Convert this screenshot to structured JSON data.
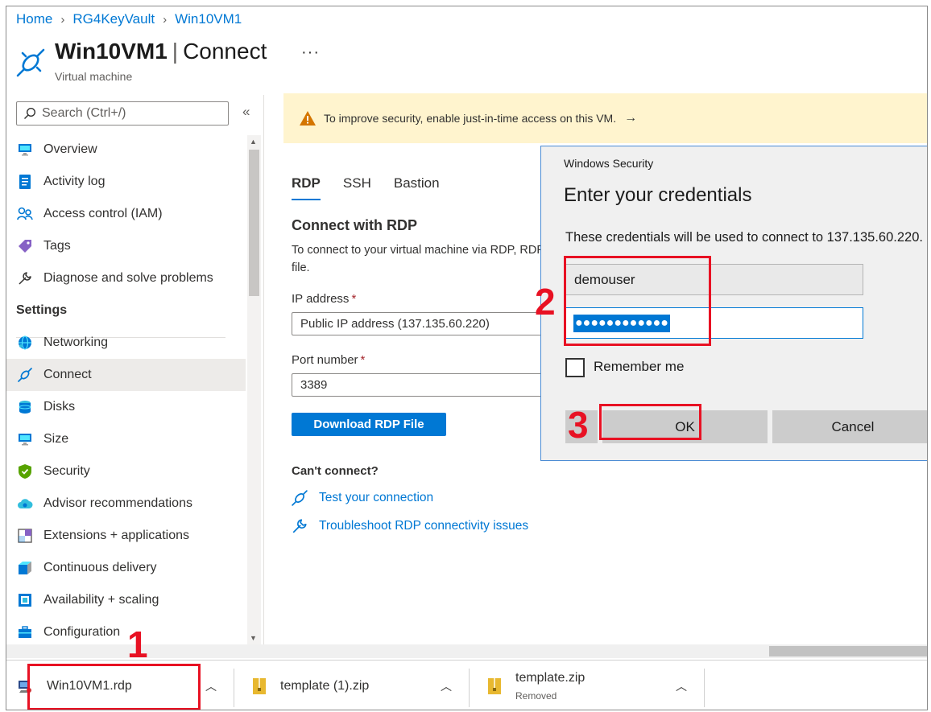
{
  "breadcrumb": [
    "Home",
    "RG4KeyVault",
    "Win10VM1"
  ],
  "header": {
    "resource": "Win10VM1",
    "page": "Connect",
    "subtitle": "Virtual machine",
    "more": "···"
  },
  "sidebar": {
    "search_placeholder": "Search (Ctrl+/)",
    "collapse": "«",
    "items_top": [
      {
        "label": "Overview",
        "icon": "monitor-icon"
      },
      {
        "label": "Activity log",
        "icon": "log-icon"
      },
      {
        "label": "Access control (IAM)",
        "icon": "people-icon"
      },
      {
        "label": "Tags",
        "icon": "tag-icon"
      },
      {
        "label": "Diagnose and solve problems",
        "icon": "wrench-icon"
      }
    ],
    "settings_heading": "Settings",
    "items_settings": [
      {
        "label": "Networking",
        "icon": "globe-icon"
      },
      {
        "label": "Connect",
        "icon": "plug-icon",
        "active": true
      },
      {
        "label": "Disks",
        "icon": "disks-icon"
      },
      {
        "label": "Size",
        "icon": "monitor-icon"
      },
      {
        "label": "Security",
        "icon": "shield-icon"
      },
      {
        "label": "Advisor recommendations",
        "icon": "cloud-icon"
      },
      {
        "label": "Extensions + applications",
        "icon": "extensions-icon"
      },
      {
        "label": "Continuous delivery",
        "icon": "delivery-icon"
      },
      {
        "label": "Availability + scaling",
        "icon": "scaling-icon"
      },
      {
        "label": "Configuration",
        "icon": "briefcase-icon"
      }
    ]
  },
  "banner": {
    "text": "To improve security, enable just-in-time access on this VM.",
    "arrow": "→"
  },
  "tabs": [
    "RDP",
    "SSH",
    "Bastion"
  ],
  "rdp": {
    "title": "Connect with RDP",
    "description": "To connect to your virtual machine via RDP, RDP file.",
    "ip_label": "IP address",
    "ip_value": "Public IP address (137.135.60.220)",
    "port_label": "Port number",
    "port_value": "3389",
    "download_button": "Download RDP File",
    "cant_connect": "Can't connect?",
    "links": [
      "Test your connection",
      "Troubleshoot RDP connectivity issues"
    ]
  },
  "dialog": {
    "caption": "Windows Security",
    "title": "Enter your credentials",
    "text": "These credentials will be used to connect to 137.135.60.220.",
    "username": "demouser",
    "password_mask": "●●●●●●●●●●●●",
    "remember_me": "Remember me",
    "ok": "OK",
    "cancel": "Cancel"
  },
  "annotations": [
    "1",
    "2",
    "3"
  ],
  "downloads": [
    {
      "name": "Win10VM1.rdp",
      "status": ""
    },
    {
      "name": "template (1).zip",
      "status": ""
    },
    {
      "name": "template.zip",
      "status": "Removed"
    }
  ],
  "colors": {
    "accent": "#0078d4",
    "annotation": "#e81123",
    "banner_bg": "#fff4ce"
  }
}
